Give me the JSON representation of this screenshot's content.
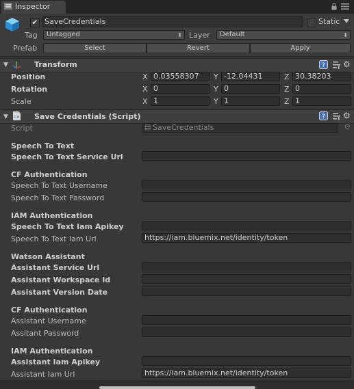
{
  "tab": {
    "title": "Inspector"
  },
  "object": {
    "name": "SaveCredentials",
    "active": true,
    "static_label": "Static",
    "static": false,
    "tag_label": "Tag",
    "tag_value": "Untagged",
    "layer_label": "Layer",
    "layer_value": "Default",
    "prefab_label": "Prefab",
    "prefab_buttons": {
      "select": "Select",
      "revert": "Revert",
      "apply": "Apply"
    }
  },
  "transform": {
    "title": "Transform",
    "rows": [
      {
        "label": "Position",
        "x": "0.03558307",
        "y": "-12.04431",
        "z": "30.38203"
      },
      {
        "label": "Rotation",
        "x": "0",
        "y": "0",
        "z": "0"
      },
      {
        "label": "Scale",
        "x": "1",
        "y": "1",
        "z": "1"
      }
    ],
    "axes": {
      "x": "X",
      "y": "Y",
      "z": "Z"
    }
  },
  "script_component": {
    "title": "Save Credentials (Script)",
    "script_label": "Script",
    "script_value": "SaveCredentials",
    "sections": {
      "s1": "Speech To Text",
      "s2": "CF Authentication",
      "s3": "IAM Authentication",
      "s4": "Watson Assistant",
      "s5": "CF Authentication",
      "s6": "IAM Authentication"
    },
    "fields": {
      "f1": {
        "label": "Speech To Text Service Url",
        "value": ""
      },
      "f2": {
        "label": "Speech To Text Username",
        "value": ""
      },
      "f3": {
        "label": "Speech To Text Password",
        "value": ""
      },
      "f4": {
        "label": "Speech To Text Iam Apikey",
        "value": ""
      },
      "f5": {
        "label": "Speech To Text Iam Url",
        "value": "https://iam.bluemix.net/identity/token"
      },
      "f6": {
        "label": "Assistant Service Url",
        "value": ""
      },
      "f7": {
        "label": "Assistant Workspace Id",
        "value": ""
      },
      "f8": {
        "label": "Assistant Version Date",
        "value": ""
      },
      "f9": {
        "label": "Assistant Username",
        "value": ""
      },
      "f10": {
        "label": "Assitant Password",
        "value": ""
      },
      "f11": {
        "label": "Assistant Iam Apikey",
        "value": ""
      },
      "f12": {
        "label": "Assistant Iam Url",
        "value": "https://iam.bluemix.net/identity/token"
      }
    }
  },
  "icons": {
    "tab": "inspector-icon",
    "lock": "lock-icon",
    "menu": "menu-icon",
    "object": "gameobject-cube-icon",
    "transform": "transform-axes-icon",
    "script": "script-file-icon",
    "help": "help-icon",
    "preset": "preset-icon",
    "gear": "gear-icon"
  },
  "colors": {
    "background": "#383838",
    "header": "#3c3c3c",
    "field": "#2f2f2f",
    "text": "#bdbdbd"
  }
}
